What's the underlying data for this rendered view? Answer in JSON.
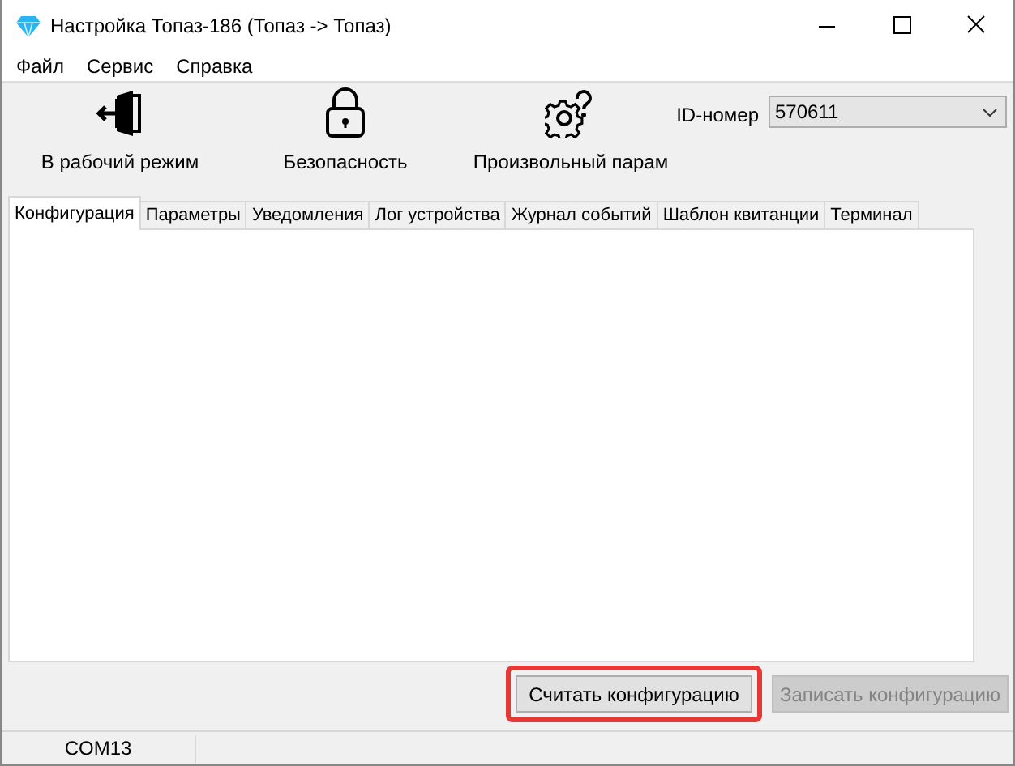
{
  "window": {
    "title": "Настройка Топаз-186 (Топаз -> Топаз)"
  },
  "menu": [
    "Файл",
    "Сервис",
    "Справка"
  ],
  "toolbar": [
    {
      "kind": "exit",
      "label": "В рабочий режим"
    },
    {
      "kind": "lock",
      "label": "Безопасность"
    },
    {
      "kind": "gear",
      "label": "Произвольный парам"
    }
  ],
  "id_field": {
    "label": "ID-номер",
    "value": "570611"
  },
  "tabs": [
    {
      "label": "Конфигурация",
      "selected": true
    },
    {
      "label": "Параметры",
      "selected": false
    },
    {
      "label": "Уведомления",
      "selected": false
    },
    {
      "label": "Лог устройства",
      "selected": false
    },
    {
      "label": "Журнал событий",
      "selected": false
    },
    {
      "label": "Шаблон квитанции",
      "selected": false
    },
    {
      "label": "Терминал",
      "selected": false
    }
  ],
  "buttons": [
    {
      "label": "Считать конфигурацию",
      "disabled": false,
      "highlighted": true
    },
    {
      "label": "Записать конфигурацию",
      "disabled": true,
      "highlighted": false
    }
  ],
  "status_bar": {
    "port": "COM13"
  }
}
